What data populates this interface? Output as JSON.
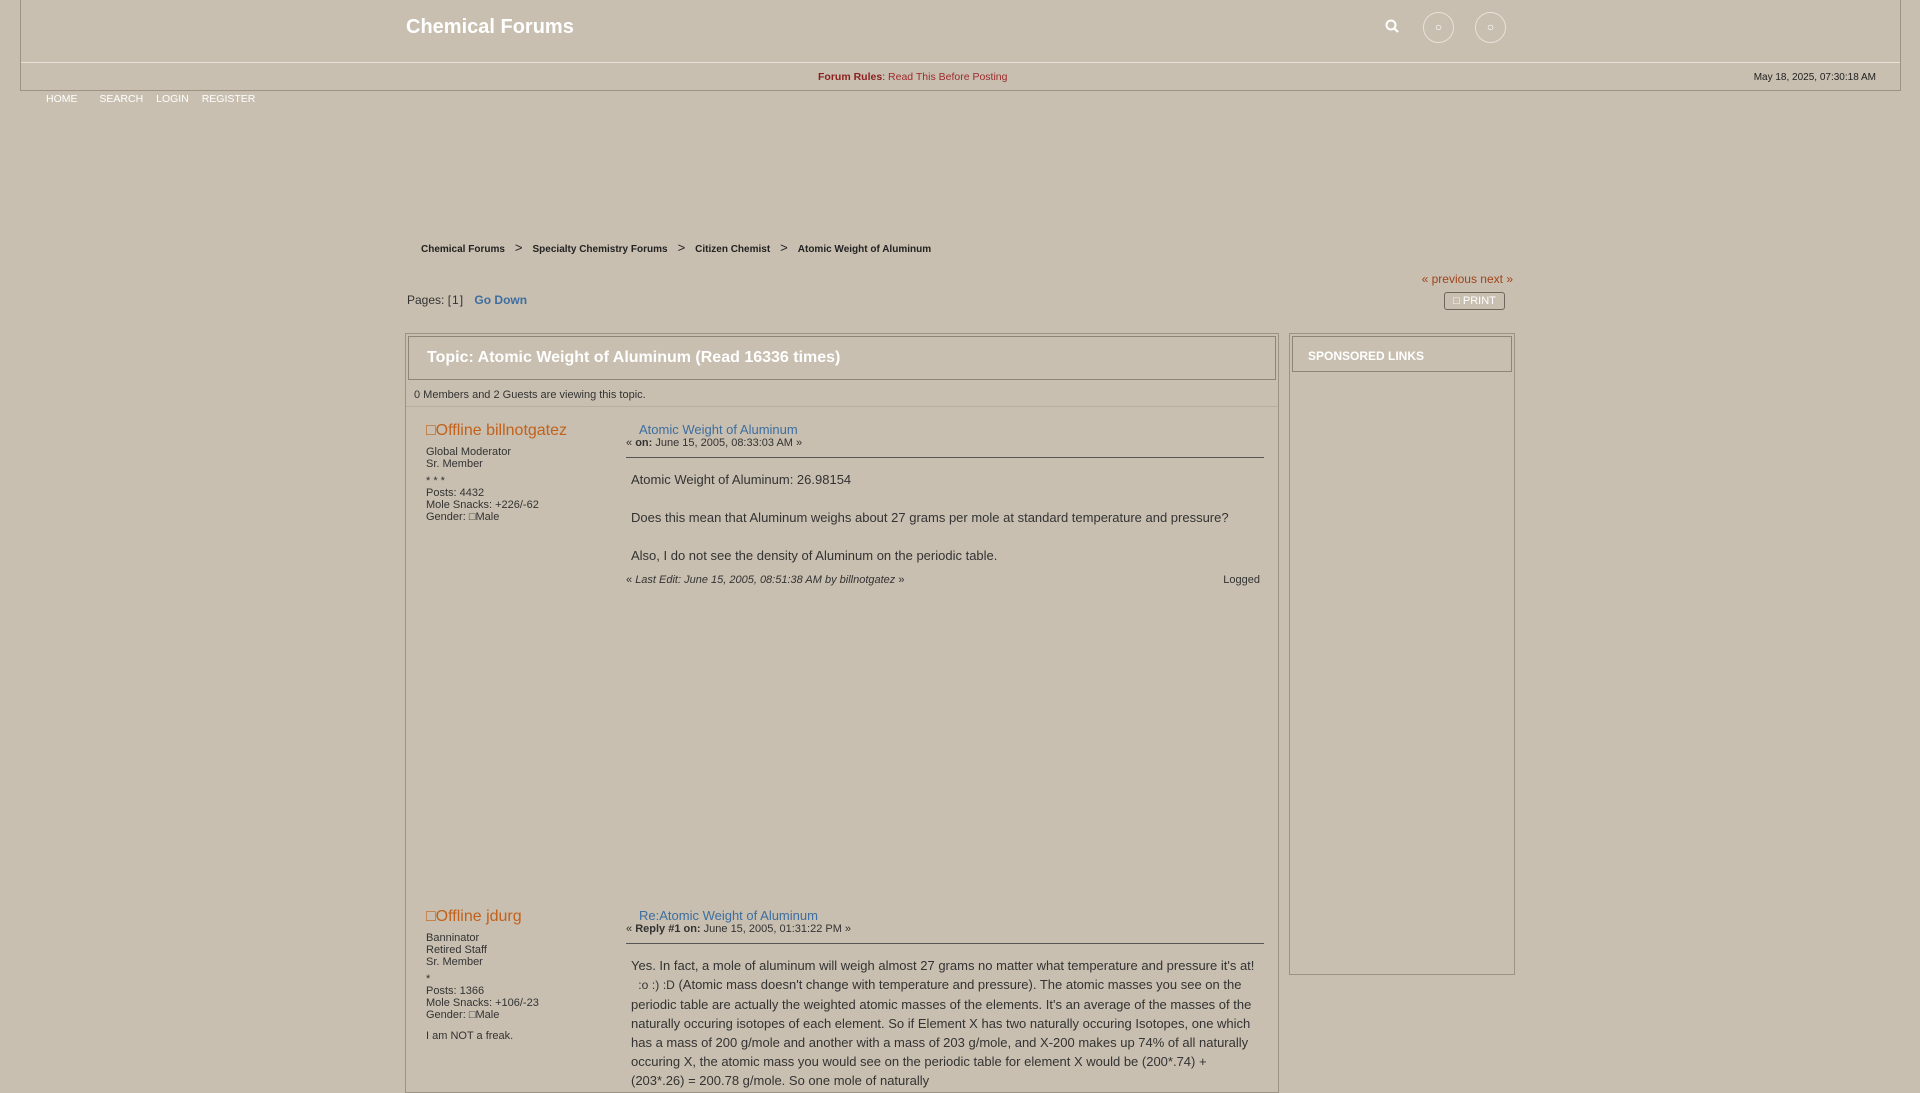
{
  "header": {
    "site_title": "Chemical Forums",
    "forum_rules_label": "Forum Rules",
    "forum_rules_link": "Read This Before Posting",
    "datetime": "May 18, 2025, 07:30:18 AM"
  },
  "nav": {
    "home": "HOME",
    "search": "SEARCH",
    "login": "LOGIN",
    "register": "REGISTER"
  },
  "breadcrumb": [
    "Chemical Forums",
    "Specialty Chemistry Forums",
    "Citizen Chemist",
    "Atomic Weight of Aluminum"
  ],
  "pagination": {
    "prev_next": "« previous next »",
    "pages_label": "Pages: [",
    "current_page": "1",
    "pages_close": "]",
    "go_down": "Go Down",
    "print": "PRINT"
  },
  "topic": {
    "title": "Topic: Atomic Weight of Aluminum  (Read 16336 times)",
    "viewing": "0 Members and 2 Guests are viewing this topic."
  },
  "posts": [
    {
      "status_alt": "Offline",
      "username": "billnotgatez",
      "roles": [
        "Global Moderator",
        "Sr. Member"
      ],
      "stars": "* * *",
      "posts": "Posts: 4432",
      "mole_snacks": "Mole Snacks: +226/-62",
      "gender_label": "Gender:",
      "gender": "Male",
      "subject": "Atomic Weight of Aluminum",
      "meta_prefix": "«",
      "meta_on": "on:",
      "meta_date": "June 15, 2005, 08:33:03 AM »",
      "body": [
        "Atomic Weight of Aluminum: 26.98154",
        "Does this mean that Aluminum weighs about 27 grams per mole at standard temperature and pressure?",
        "Also, I do not see the density of Aluminum on the periodic table."
      ],
      "last_edit": "Last Edit: June 15, 2005, 08:51:38 AM by billnotgatez",
      "logged": "Logged"
    },
    {
      "status_alt": "Offline",
      "username": "jdurg",
      "roles": [
        "Banninator",
        "Retired Staff",
        "Sr. Member"
      ],
      "stars": "*",
      "posts": "Posts: 1366",
      "mole_snacks": "Mole Snacks: +106/-23",
      "gender_label": "Gender:",
      "gender": "Male",
      "signature": "I am NOT a freak.",
      "subject": "Re:Atomic Weight of Aluminum",
      "meta_prefix": "«",
      "meta_on": "Reply #1 on:",
      "meta_date": "June 15, 2005, 01:31:22 PM »",
      "body_a": "Yes.  In fact, a mole of aluminum will weigh almost 27 grams no matter what temperature and pressure it's at!",
      "emotes": [
        ":o",
        ":)",
        ":D"
      ],
      "body_b": "(Atomic mass doesn't change with temperature and pressure).  The atomic masses you see on the periodic table are actually the weighted atomic masses of the elements.  It's an average of the masses of the naturally occuring isotopes of each element.  So if Element X has two naturally occuring Isotopes, one which has a mass of 200 g/mole and another with a mass of 203 g/mole, and X-200 makes up 74% of all naturally occuring X, the atomic mass you would see on the periodic table for element X would be (200*.74) + (203*.26) = 200.78 g/mole.  So one mole of naturally"
    }
  ],
  "sidebar": {
    "sponsored_title": "SPONSORED LINKS"
  }
}
